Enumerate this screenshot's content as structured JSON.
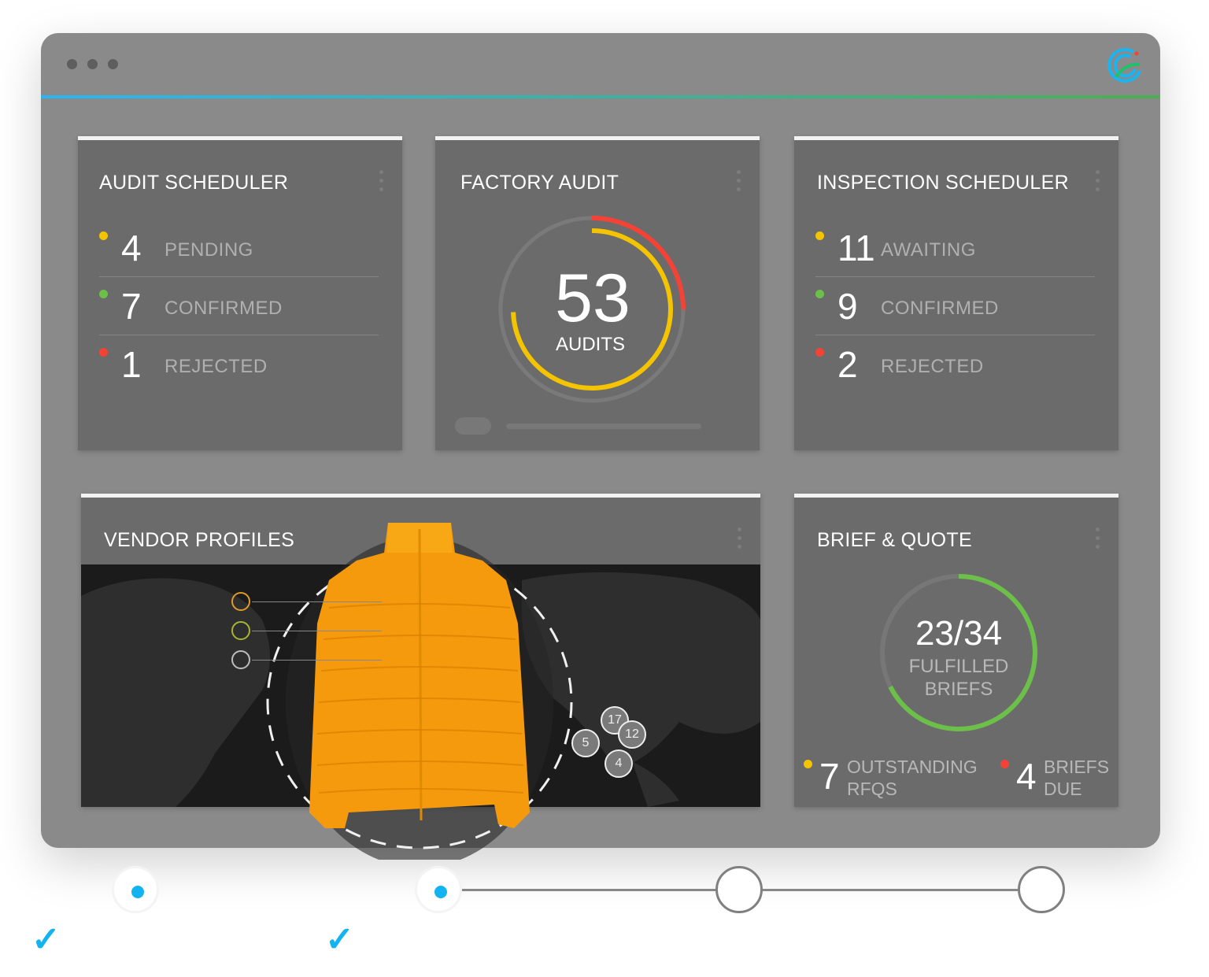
{
  "window": {
    "accent_start": "#29b6f6",
    "accent_end": "#4caf50",
    "logo_icon": "swirl-logo-icon"
  },
  "audit_scheduler": {
    "title": "AUDIT SCHEDULER",
    "rows": [
      {
        "count": "4",
        "label": "PENDING",
        "color": "#f5c400"
      },
      {
        "count": "7",
        "label": "CONFIRMED",
        "color": "#6cc04a"
      },
      {
        "count": "1",
        "label": "REJECTED",
        "color": "#f44336"
      }
    ]
  },
  "factory_audit": {
    "title": "FACTORY AUDIT",
    "value": "53",
    "unit": "AUDITS",
    "colors": {
      "primary": "#f5c400",
      "secondary": "#f44336"
    }
  },
  "inspection_scheduler": {
    "title": "INSPECTION SCHEDULER",
    "rows": [
      {
        "count": "11",
        "label": "AWAITING",
        "color": "#f5c400"
      },
      {
        "count": "9",
        "label": "CONFIRMED",
        "color": "#6cc04a"
      },
      {
        "count": "2",
        "label": "REJECTED",
        "color": "#f44336"
      }
    ]
  },
  "vendor_profiles": {
    "title": "VENDOR PROFILES",
    "clusters": [
      "17",
      "12",
      "5",
      "4"
    ],
    "legend_colors": [
      "#e09a2a",
      "#a8b532",
      "#bdbdbd"
    ]
  },
  "brief_quote": {
    "title": "BRIEF & QUOTE",
    "fraction": "23/34",
    "fulfilled": 23,
    "total": 34,
    "label1": "FULFILLED",
    "label2": "BRIEFS",
    "stats": [
      {
        "count": "7",
        "line1": "OUTSTANDING",
        "line2": "RFQS",
        "color": "#f5c400"
      },
      {
        "count": "4",
        "line1": "BRIEFS",
        "line2": "DUE",
        "color": "#f44336"
      }
    ],
    "color": "#6cc04a"
  },
  "stepper": {
    "steps": [
      {
        "done": true
      },
      {
        "done": true
      },
      {
        "done": false
      },
      {
        "done": false
      }
    ],
    "accent": "#12b3f0"
  }
}
